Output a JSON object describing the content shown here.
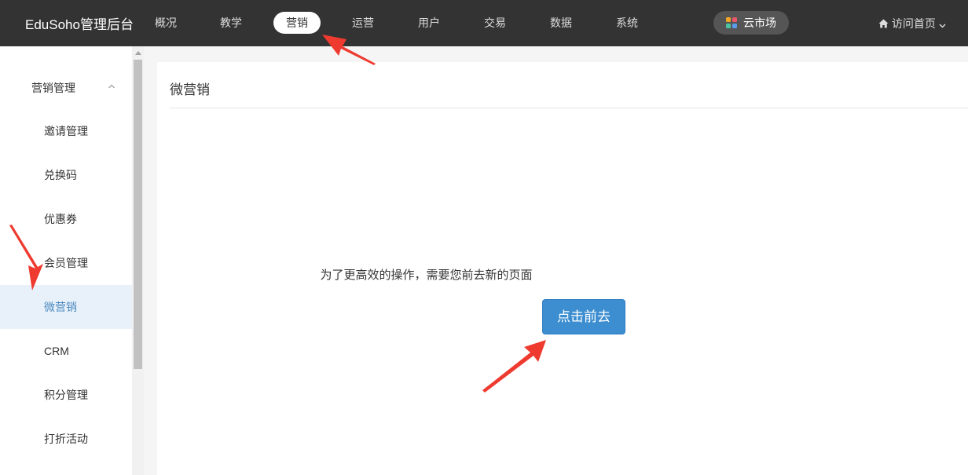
{
  "header": {
    "brand": "EduSoho管理后台",
    "nav": [
      "概况",
      "教学",
      "营销",
      "运营",
      "用户",
      "交易",
      "数据",
      "系统"
    ],
    "active_nav": "营销",
    "cloud_market": "云市场",
    "visit_home": "访问首页"
  },
  "sidebar": {
    "group_label": "营销管理",
    "items": [
      {
        "label": "邀请管理"
      },
      {
        "label": "兑换码"
      },
      {
        "label": "优惠券"
      },
      {
        "label": "会员管理"
      },
      {
        "label": "微营销"
      },
      {
        "label": "CRM"
      },
      {
        "label": "积分管理"
      },
      {
        "label": "打折活动"
      }
    ],
    "active_item": "微营销"
  },
  "main": {
    "title": "微营销",
    "notice": "为了更高效的操作，需要您前去新的页面",
    "button_label": "点击前去"
  },
  "colors": {
    "topbar": "#333333",
    "accent": "#3c8ed1",
    "sidebar_active_bg": "#e8f1f9",
    "annotation_arrow": "#ee3a2f"
  },
  "icons": [
    "home-icon",
    "chevron-down-icon",
    "chevron-up-icon",
    "app-grid-icon"
  ]
}
